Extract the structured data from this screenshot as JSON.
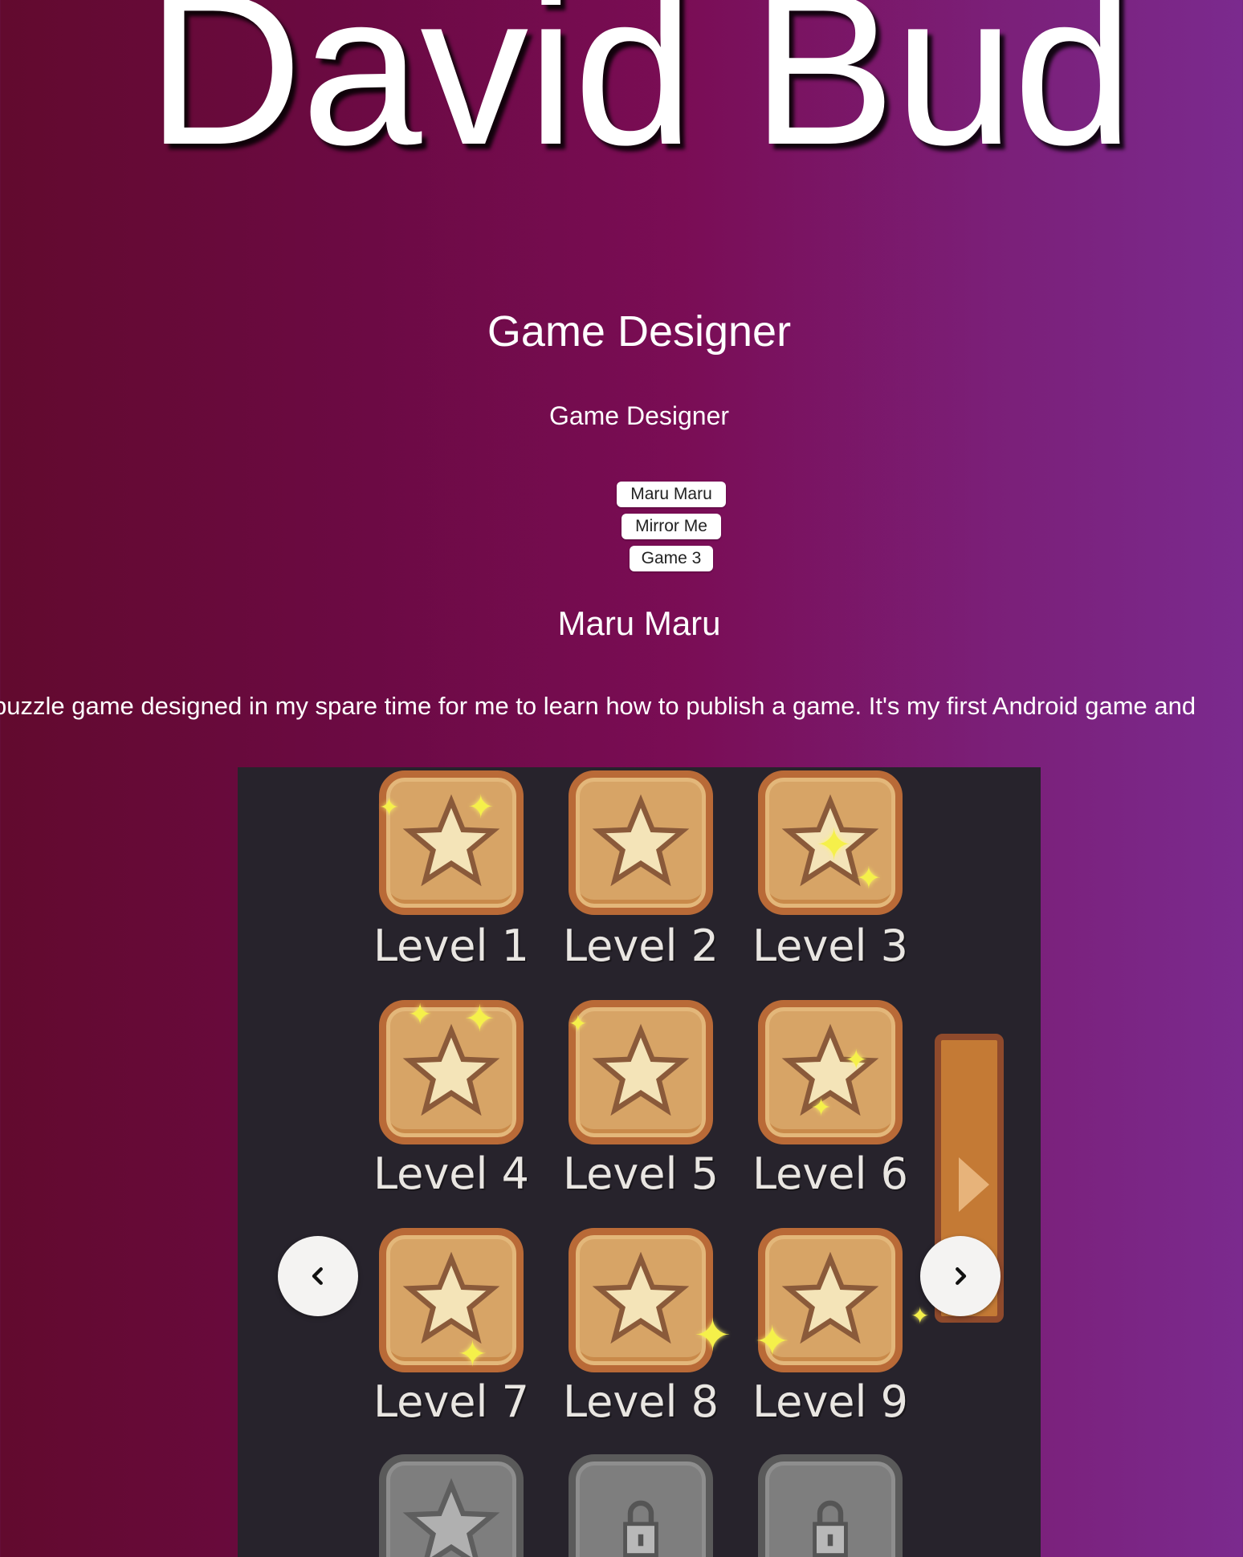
{
  "header": {
    "name": "David Bud",
    "role_heading": "Game Designer",
    "role_sub": "Game Designer"
  },
  "game_menu": {
    "items": [
      {
        "label": "Maru Maru"
      },
      {
        "label": "Mirror Me"
      },
      {
        "label": "Game 3"
      }
    ]
  },
  "game": {
    "title": "Maru Maru",
    "description": "puzzle game designed in my spare time for me to learn how to publish a game. It's my first Android game and"
  },
  "carousel": {
    "levels": [
      {
        "label": "Level 1",
        "state": "unlocked"
      },
      {
        "label": "Level 2",
        "state": "unlocked"
      },
      {
        "label": "Level 3",
        "state": "unlocked"
      },
      {
        "label": "Level 4",
        "state": "unlocked"
      },
      {
        "label": "Level 5",
        "state": "unlocked"
      },
      {
        "label": "Level 6",
        "state": "unlocked"
      },
      {
        "label": "Level 7",
        "state": "unlocked"
      },
      {
        "label": "Level 8",
        "state": "unlocked"
      },
      {
        "label": "Level 9",
        "state": "unlocked"
      },
      {
        "state": "locked"
      },
      {
        "state": "locked"
      },
      {
        "state": "locked"
      }
    ],
    "prev_icon": "chevron-left-icon",
    "next_icon": "chevron-right-icon"
  },
  "colors": {
    "background_left": "#620a2e",
    "background_right": "#7b2a8e",
    "carousel_bg": "#27232c",
    "tile_fill": "#d7a466",
    "tile_border": "#b96a37",
    "sparkle": "#f5f04a"
  }
}
